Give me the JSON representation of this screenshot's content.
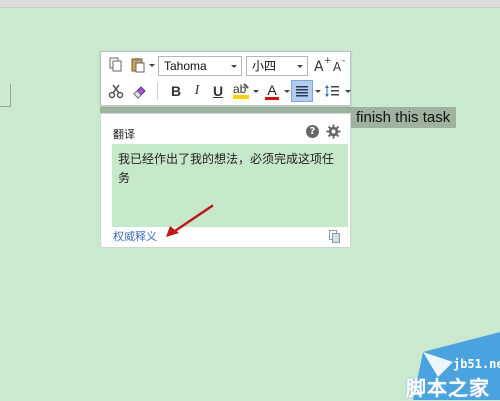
{
  "document": {
    "selected_text": "finish this task"
  },
  "toolbar": {
    "font_family": "Tahoma",
    "font_size": "小四",
    "row1_icons": [
      "copy-icon",
      "paste-icon",
      "grow-font-icon",
      "shrink-font-icon"
    ],
    "row2": {
      "bold": "B",
      "italic": "I",
      "underline": "U",
      "font_color_letter": "A"
    },
    "colors": {
      "highlight": "#f5d400",
      "font_color": "#d01010",
      "accent_blue": "#2a6ad0"
    }
  },
  "popup": {
    "title": "翻译",
    "translation": "我已经作出了我的想法，必须完成这项任务",
    "link": "权威释义"
  },
  "watermark": {
    "site": "jb51.net",
    "name": "脚本之家"
  }
}
